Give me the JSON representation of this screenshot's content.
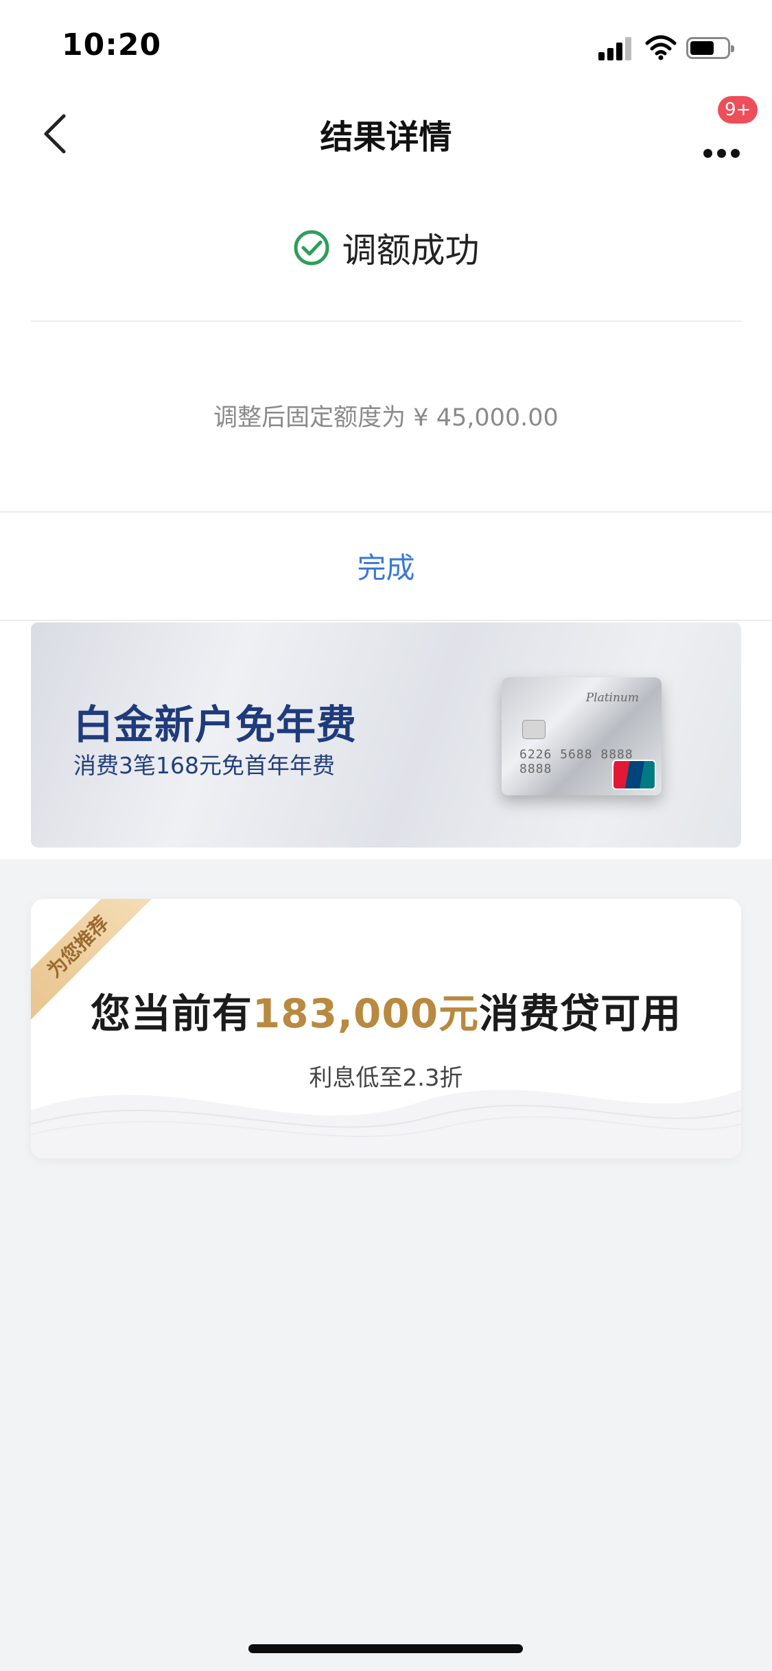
{
  "status_bar": {
    "time": "10:20"
  },
  "nav": {
    "title": "结果详情",
    "badge": "9+"
  },
  "result": {
    "status_text": "调额成功",
    "limit_text": "调整后固定额度为 ¥ 45,000.00",
    "done_label": "完成"
  },
  "banner": {
    "title": "白金新户免年费",
    "subtitle": "消费3笔168元免首年年费",
    "card": {
      "brand": "Platinum",
      "number": "6226 5688 8888 8888",
      "network": "UnionPay 银联"
    }
  },
  "loan": {
    "ribbon": "为您推荐",
    "title_prefix": "您当前有",
    "amount": "183,000元",
    "title_suffix": "消费贷可用",
    "subtitle": "利息低至2.3折"
  },
  "colors": {
    "accent_blue": "#3a78d6",
    "success_green": "#2e9e5b",
    "badge_red": "#ee4d5a",
    "banner_navy": "#1f3b7c",
    "loan_gold": "#b8893f"
  }
}
